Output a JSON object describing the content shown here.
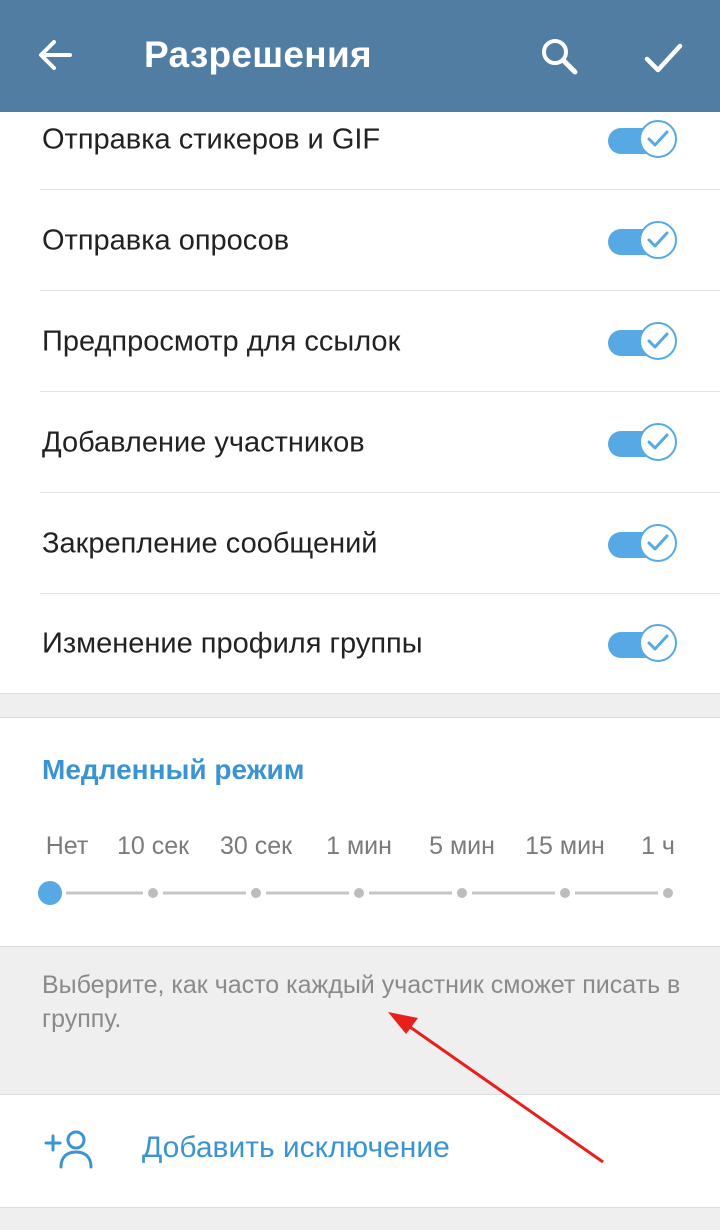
{
  "toolbar": {
    "title": "Разрешения",
    "back_icon": "arrow-left-icon",
    "search_icon": "search-icon",
    "done_icon": "checkmark-icon",
    "background_color": "#527da3"
  },
  "permissions": [
    {
      "label": "Отправка стикеров и GIF",
      "enabled": true
    },
    {
      "label": "Отправка опросов",
      "enabled": true
    },
    {
      "label": "Предпросмотр для ссылок",
      "enabled": true
    },
    {
      "label": "Добавление участников",
      "enabled": true
    },
    {
      "label": "Закрепление сообщений",
      "enabled": true
    },
    {
      "label": "Изменение профиля группы",
      "enabled": true
    }
  ],
  "slow_mode": {
    "title": "Медленный режим",
    "options": [
      "Нет",
      "10 сек",
      "30 сек",
      "1 мин",
      "5 мин",
      "15 мин",
      "1 ч"
    ],
    "selected_index": 0,
    "hint": "Выберите, как часто каждый участник сможет писать в группу."
  },
  "add_exception": {
    "label": "Добавить исключение",
    "icon": "add-user-icon"
  },
  "colors": {
    "accent": "#3a94d3",
    "toggle_on": "#56a9e4",
    "annotation_arrow": "#e8201c"
  }
}
